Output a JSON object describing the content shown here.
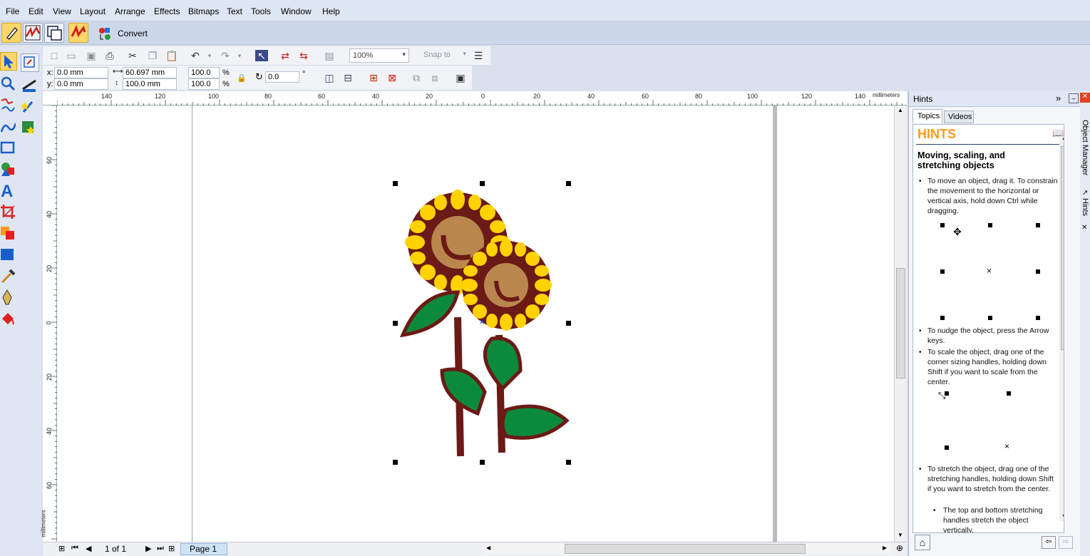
{
  "menu": [
    "File",
    "Edit",
    "View",
    "Layout",
    "Arrange",
    "Effects",
    "Bitmaps",
    "Text",
    "Tools",
    "Window",
    "Help"
  ],
  "modebar": {
    "convert_label": "Convert"
  },
  "stdbar": {
    "zoom": "100%",
    "snap_to": "Snap to"
  },
  "propbar": {
    "x_label": "x:",
    "x_value": "0.0 mm",
    "y_label": "y:",
    "y_value": "0.0 mm",
    "width_value": "60.697 mm",
    "height_value": "100.0 mm",
    "scale_x": "100.0",
    "scale_y": "100.0",
    "percent": "%",
    "rotation": "0.0",
    "degree": "°"
  },
  "hruler": {
    "unit": "millimeters",
    "ticks": [
      "140",
      "120",
      "100",
      "80",
      "60",
      "40",
      "20",
      "0",
      "20",
      "40",
      "60",
      "80",
      "100",
      "120",
      "140"
    ]
  },
  "vruler": {
    "unit": "millimeters",
    "ticks": [
      "60",
      "40",
      "20",
      "0",
      "20",
      "40",
      "60"
    ]
  },
  "pagenav": {
    "page_count": "1 of 1",
    "page_tab": "Page 1"
  },
  "docker": {
    "title": "Hints",
    "tabs": [
      "Topics",
      "Videos"
    ],
    "heading": "HINTS",
    "section_title": "Moving, scaling, and stretching objects",
    "hints": [
      "To move an object, drag it. To constrain the movement to the horizontal or vertical axis, hold down Ctrl while dragging.",
      "To nudge the object, press the Arrow keys.",
      "To scale the object, drag one of the corner sizing handles, holding down Shift if you want to scale from the center.",
      "To stretch the object, drag one of the stretching handles, holding down Shift if you want to stretch from the center.",
      "The top and bottom stretching handles stretch the object vertically."
    ]
  },
  "sidetabs": [
    "Object Manager",
    "Hints"
  ],
  "colors": {
    "accent": "#ff9a1a",
    "selection": "#ffd66b",
    "leaf": "#0b8a3c",
    "stem": "#6b1a16",
    "petal": "#ffd200",
    "center": "#b9864e"
  }
}
